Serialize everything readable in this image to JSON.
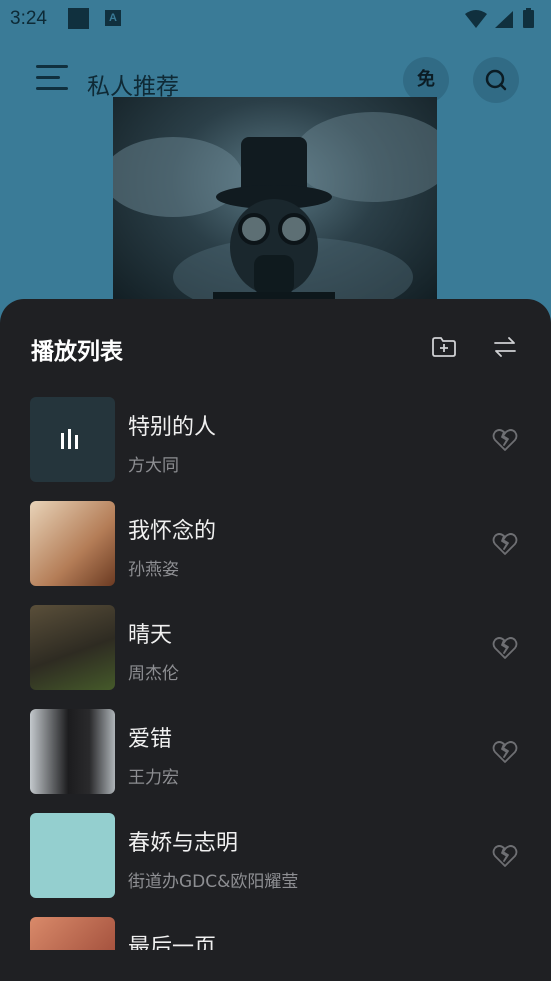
{
  "status_bar": {
    "time": "3:24",
    "notification_badge": "A"
  },
  "header": {
    "title": "私人推荐",
    "free_badge": "免"
  },
  "playlist": {
    "title": "播放列表",
    "tracks": [
      {
        "title": "特别的人",
        "artist": "方大同",
        "playing": true,
        "art_color": "#25353c"
      },
      {
        "title": "我怀念的",
        "artist": "孙燕姿",
        "playing": false,
        "art_color": "#c9a98a"
      },
      {
        "title": "晴天",
        "artist": "周杰伦",
        "playing": false,
        "art_color": "#3c3a2e"
      },
      {
        "title": "爱错",
        "artist": "王力宏",
        "playing": false,
        "art_color": "#b9bec2"
      },
      {
        "title": "春娇与志明",
        "artist": "街道办GDC&欧阳耀莹",
        "playing": false,
        "art_color": "#94cfcf"
      },
      {
        "title": "最后一页",
        "artist": "",
        "playing": false,
        "art_color": "#a5503e"
      }
    ]
  },
  "colors": {
    "background": "#3a7b97",
    "sheet": "#1f2023",
    "text_primary": "#f0f0f0",
    "text_secondary": "#8d8e92"
  },
  "icons": {
    "menu": "hamburger-icon",
    "search": "search-icon",
    "folder": "folder-add-icon",
    "play_mode": "sequential-play-icon",
    "dislike": "broken-heart-icon"
  }
}
